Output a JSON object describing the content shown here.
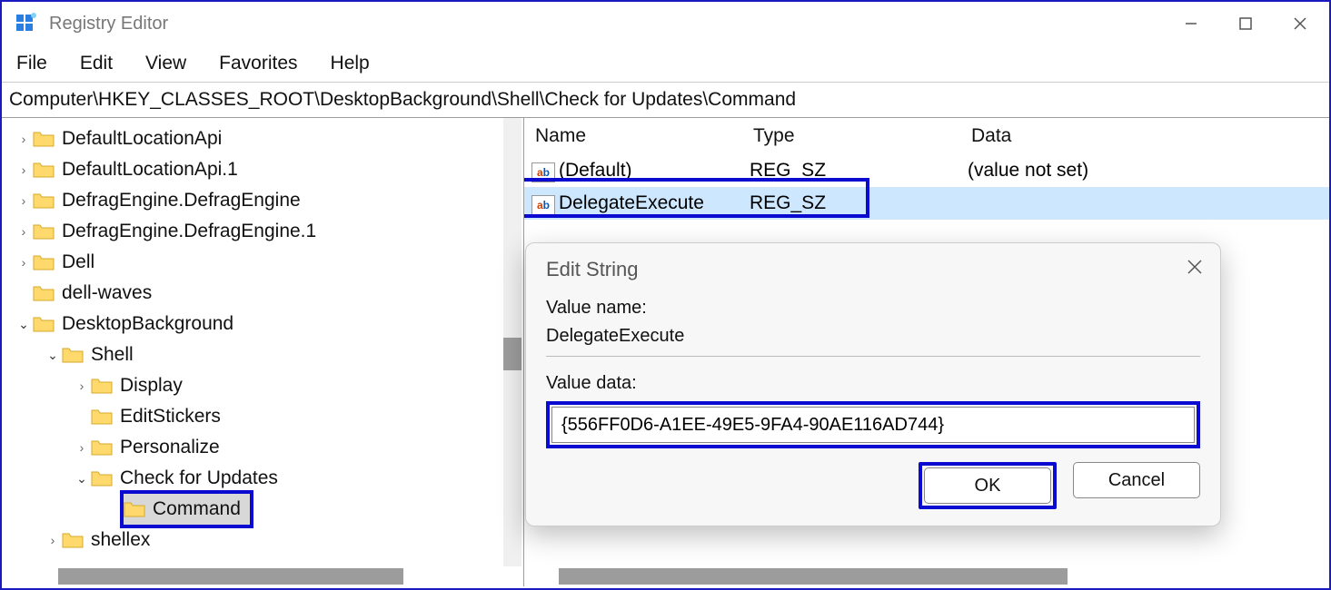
{
  "window": {
    "title": "Registry Editor"
  },
  "menubar": [
    "File",
    "Edit",
    "View",
    "Favorites",
    "Help"
  ],
  "address": "Computer\\HKEY_CLASSES_ROOT\\DesktopBackground\\Shell\\Check for Updates\\Command",
  "tree": [
    {
      "indent": 0,
      "chev": ">",
      "label": "DefaultLocationApi"
    },
    {
      "indent": 0,
      "chev": ">",
      "label": "DefaultLocationApi.1"
    },
    {
      "indent": 0,
      "chev": ">",
      "label": "DefragEngine.DefragEngine"
    },
    {
      "indent": 0,
      "chev": ">",
      "label": "DefragEngine.DefragEngine.1"
    },
    {
      "indent": 0,
      "chev": ">",
      "label": "Dell"
    },
    {
      "indent": 0,
      "chev": "",
      "label": "dell-waves"
    },
    {
      "indent": 0,
      "chev": "v",
      "label": "DesktopBackground"
    },
    {
      "indent": 1,
      "chev": "v",
      "label": "Shell"
    },
    {
      "indent": 2,
      "chev": ">",
      "label": "Display"
    },
    {
      "indent": 2,
      "chev": "",
      "label": "EditStickers"
    },
    {
      "indent": 2,
      "chev": ">",
      "label": "Personalize"
    },
    {
      "indent": 2,
      "chev": "v",
      "label": "Check for Updates"
    },
    {
      "indent": 3,
      "chev": "",
      "label": "Command",
      "selected": true
    },
    {
      "indent": 1,
      "chev": ">",
      "label": "shellex"
    }
  ],
  "gridHeaders": {
    "name": "Name",
    "type": "Type",
    "data": "Data"
  },
  "gridRows": [
    {
      "name": "(Default)",
      "type": "REG_SZ",
      "data": "(value not set)"
    },
    {
      "name": "DelegateExecute",
      "type": "REG_SZ",
      "data": "",
      "selected": true,
      "highlighted": true
    }
  ],
  "dialog": {
    "title": "Edit String",
    "valueNameLabel": "Value name:",
    "valueName": "DelegateExecute",
    "valueDataLabel": "Value data:",
    "valueData": "{556FF0D6-A1EE-49E5-9FA4-90AE116AD744}",
    "ok": "OK",
    "cancel": "Cancel"
  }
}
